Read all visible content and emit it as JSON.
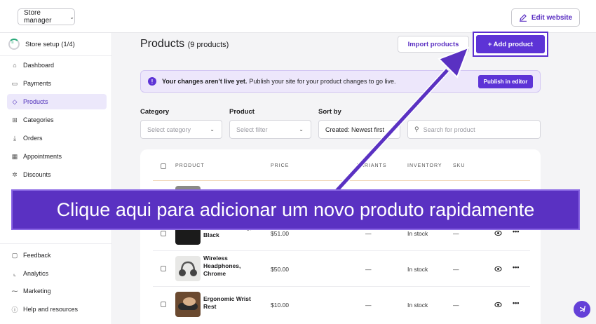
{
  "topbar": {
    "store_selector": "Store manager",
    "edit_website": "Edit website"
  },
  "sidebar": {
    "setup": "Store setup (1/4)",
    "setup_progress": "1/4",
    "items": [
      {
        "label": "Dashboard",
        "icon": "home-icon"
      },
      {
        "label": "Payments",
        "icon": "card-icon"
      },
      {
        "label": "Products",
        "icon": "tag-icon",
        "active": true
      },
      {
        "label": "Categories",
        "icon": "grid-icon"
      },
      {
        "label": "Orders",
        "icon": "download-icon"
      },
      {
        "label": "Appointments",
        "icon": "calendar-icon"
      },
      {
        "label": "Discounts",
        "icon": "discount-icon"
      }
    ],
    "bottom_items": [
      {
        "label": "Feedback",
        "icon": "chat-icon"
      },
      {
        "label": "Analytics",
        "icon": "chart-icon"
      },
      {
        "label": "Marketing",
        "icon": "trend-icon"
      },
      {
        "label": "Help and resources",
        "icon": "help-icon"
      }
    ]
  },
  "main": {
    "title": "Products",
    "count": "(9 products)",
    "import_label": "Import products",
    "add_label": "+ Add product",
    "banner_bold": "Your changes aren’t live yet.",
    "banner_text": "Publish your site for your product changes to go live.",
    "publish_label": "Publish in editor",
    "filters": {
      "category_label": "Category",
      "category_placeholder": "Select category",
      "product_label": "Product",
      "product_placeholder": "Select filter",
      "sort_label": "Sort by",
      "sort_value": "Created: Newest first",
      "search_placeholder": "Search for product"
    },
    "table": {
      "headers": [
        "PRODUCT",
        "PRICE",
        "VARIANTS",
        "INVENTORY",
        "SKU"
      ],
      "rows": [
        {
          "name_line1": "Noise-Canceling,",
          "name_line2": "Black",
          "price": "$51.00",
          "variants": "—",
          "inventory": "In stock",
          "sku": "—"
        },
        {
          "name_line1": "Wireless",
          "name_line2": "Headphones,",
          "name_line3": "Chrome",
          "price": "$50.00",
          "variants": "—",
          "inventory": "In stock",
          "sku": "—"
        },
        {
          "name_line1": "Ergonomic Wrist",
          "name_line2": "Rest",
          "price": "$10.00",
          "variants": "—",
          "inventory": "In stock",
          "sku": "—"
        }
      ]
    }
  },
  "overlay": {
    "callout": "Clique aqui para adicionar um novo produto rapidamente"
  },
  "colors": {
    "accent": "#5d33d6",
    "banner_bg": "#ede7fb",
    "callout_bg": "#5a31c2"
  }
}
